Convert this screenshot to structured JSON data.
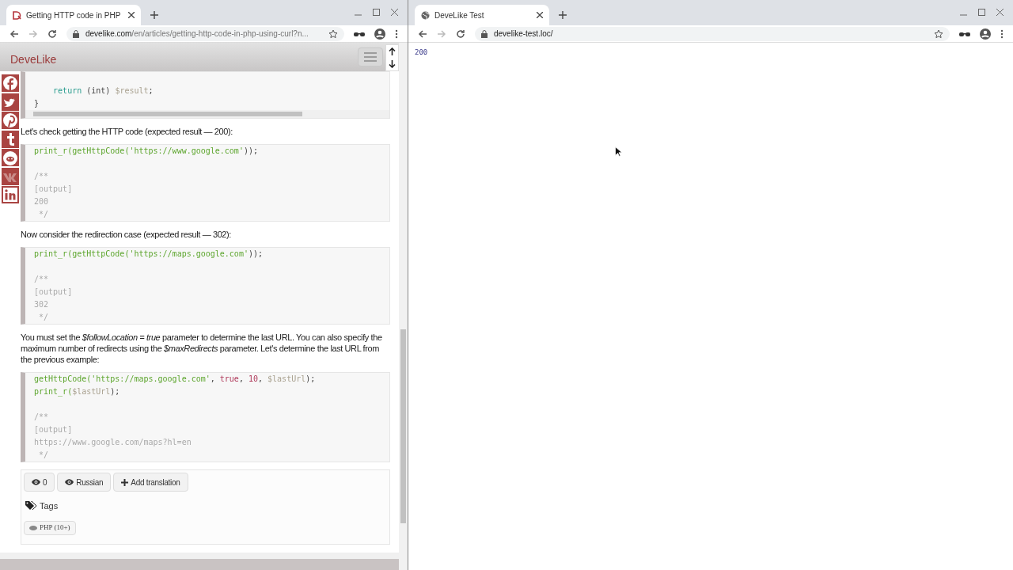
{
  "left_window": {
    "tab_title": "Getting HTTP code in PHP",
    "url_host": "develike.com",
    "url_path": "/en/articles/getting-http-code-in-php-using-curl?n...",
    "logo": "DeveLike",
    "content": [
      {
        "kind": "code",
        "h_scrollbar": true,
        "lines": [
          {
            "kind": "blank"
          },
          {
            "kind": "code",
            "segments": [
              {
                "text": "    return",
                "kind": "kw"
              },
              {
                "text": " (int) ",
                "kind": "plain"
              },
              {
                "text": "$result",
                "kind": "var"
              },
              {
                "text": ";",
                "kind": "plain"
              }
            ]
          },
          {
            "kind": "code",
            "segments": [
              {
                "text": "}",
                "kind": "plain"
              }
            ]
          }
        ]
      },
      {
        "kind": "paragraph",
        "text": "Let's check getting the HTTP code (expected result — 200):"
      },
      {
        "kind": "code",
        "h_scrollbar": false,
        "lines": [
          {
            "kind": "code",
            "segments": [
              {
                "text": "print_r(getHttpCode(",
                "kind": "fn"
              },
              {
                "text": "'https://www.google.com'",
                "kind": "str"
              },
              {
                "text": "));",
                "kind": "plain"
              }
            ]
          },
          {
            "kind": "blank"
          },
          {
            "kind": "code",
            "segments": [
              {
                "text": "/**",
                "kind": "com"
              }
            ]
          },
          {
            "kind": "code",
            "segments": [
              {
                "text": "[output]",
                "kind": "com"
              }
            ]
          },
          {
            "kind": "code",
            "segments": [
              {
                "text": "200",
                "kind": "com"
              }
            ]
          },
          {
            "kind": "code",
            "segments": [
              {
                "text": " */",
                "kind": "com"
              }
            ]
          }
        ]
      },
      {
        "kind": "paragraph",
        "text": "Now consider the redirection case (expected result — 302):"
      },
      {
        "kind": "code",
        "h_scrollbar": false,
        "lines": [
          {
            "kind": "code",
            "segments": [
              {
                "text": "print_r(getHttpCode(",
                "kind": "fn"
              },
              {
                "text": "'https://maps.google.com'",
                "kind": "str"
              },
              {
                "text": "));",
                "kind": "plain"
              }
            ]
          },
          {
            "kind": "blank"
          },
          {
            "kind": "code",
            "segments": [
              {
                "text": "/**",
                "kind": "com"
              }
            ]
          },
          {
            "kind": "code",
            "segments": [
              {
                "text": "[output]",
                "kind": "com"
              }
            ]
          },
          {
            "kind": "code",
            "segments": [
              {
                "text": "302",
                "kind": "com"
              }
            ]
          },
          {
            "kind": "code",
            "segments": [
              {
                "text": " */",
                "kind": "com"
              }
            ]
          }
        ]
      },
      {
        "kind": "paragraph",
        "text": "You must set the *$followLocation = true* parameter to determine the last URL. You can also specify the maximum number of redirects using the *$maxRedirects* parameter. Let's determine the last URL from the previous example:"
      },
      {
        "kind": "code",
        "h_scrollbar": false,
        "lines": [
          {
            "kind": "code",
            "segments": [
              {
                "text": "getHttpCode(",
                "kind": "fn"
              },
              {
                "text": "'https://maps.google.com'",
                "kind": "str"
              },
              {
                "text": ", ",
                "kind": "plain"
              },
              {
                "text": "true",
                "kind": "bool"
              },
              {
                "text": ", ",
                "kind": "plain"
              },
              {
                "text": "10",
                "kind": "num"
              },
              {
                "text": ", ",
                "kind": "plain"
              },
              {
                "text": "$lastUrl",
                "kind": "var"
              },
              {
                "text": ");",
                "kind": "plain"
              }
            ]
          },
          {
            "kind": "code",
            "segments": [
              {
                "text": "print_r(",
                "kind": "fn"
              },
              {
                "text": "$lastUrl",
                "kind": "var"
              },
              {
                "text": ");",
                "kind": "plain"
              }
            ]
          },
          {
            "kind": "blank"
          },
          {
            "kind": "code",
            "segments": [
              {
                "text": "/**",
                "kind": "com"
              }
            ]
          },
          {
            "kind": "code",
            "segments": [
              {
                "text": "[output]",
                "kind": "com"
              }
            ]
          },
          {
            "kind": "code",
            "segments": [
              {
                "text": "https://www.google.com/maps?hl=en",
                "kind": "com"
              }
            ]
          },
          {
            "kind": "code",
            "segments": [
              {
                "text": " */",
                "kind": "com"
              }
            ]
          }
        ]
      }
    ],
    "footer": {
      "buttons": [
        {
          "kind": "eye",
          "label": "0"
        },
        {
          "kind": "eye",
          "label": "Russian"
        },
        {
          "kind": "plus",
          "label": "Add translation"
        }
      ],
      "tags_heading": "Tags",
      "tags": [
        "PHP (10+)"
      ]
    }
  },
  "right_window": {
    "tab_title": "DeveLike Test",
    "url": "develike-test.loc/",
    "output": "200"
  }
}
